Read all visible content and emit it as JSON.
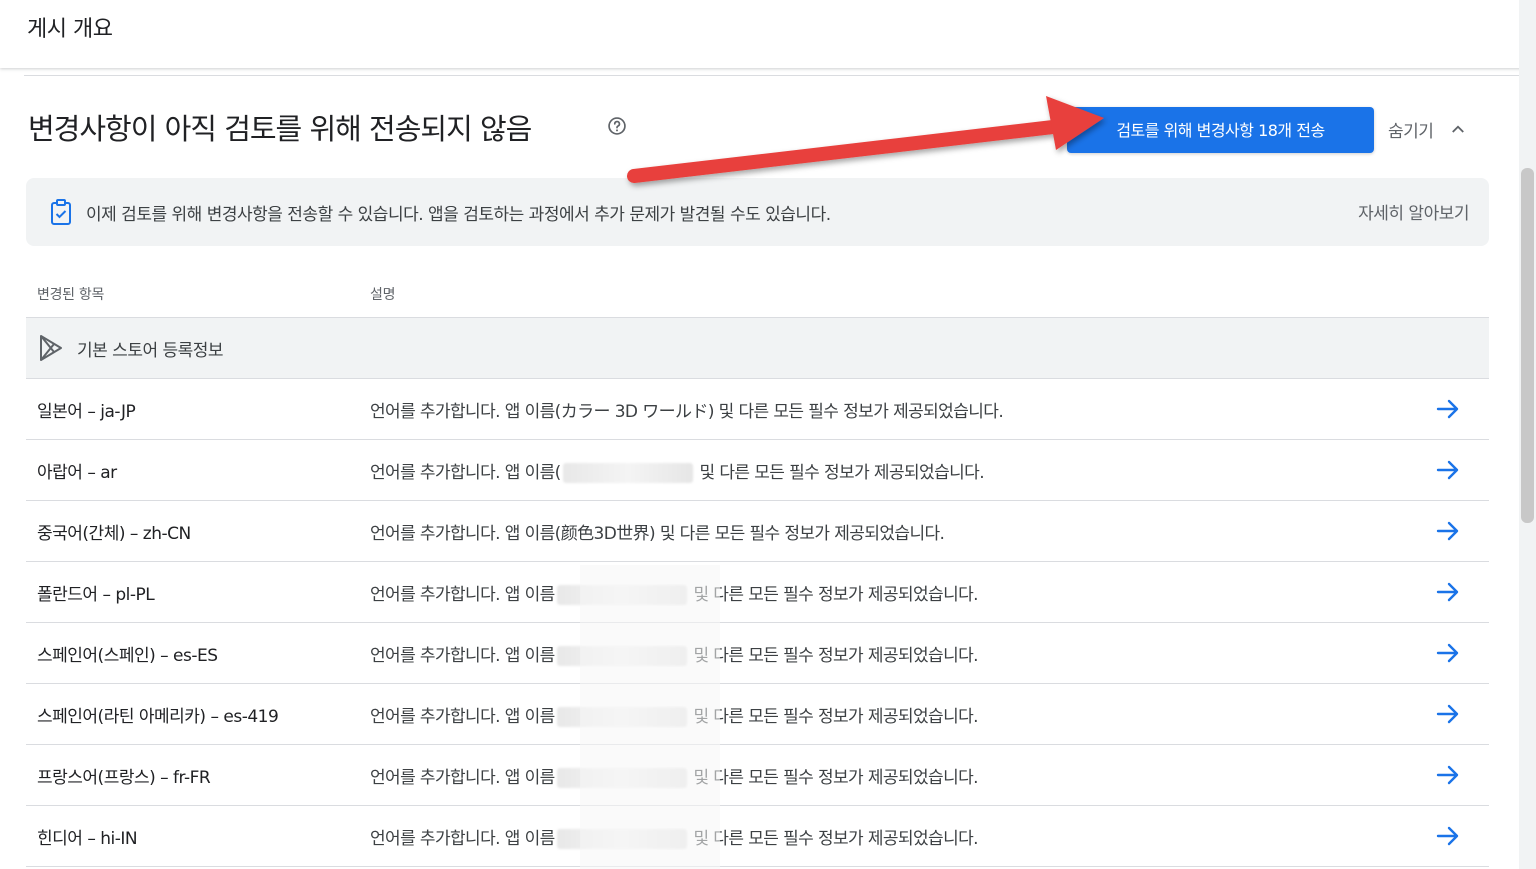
{
  "page": {
    "title": "게시 개요"
  },
  "header": {
    "heading": "변경사항이 아직 검토를 위해 전송되지 않음",
    "primary_button": "검토를 위해 변경사항 18개 전송",
    "hide_label": "숨기기"
  },
  "banner": {
    "text": "이제 검토를 위해 변경사항을 전송할 수 있습니다. 앱을 검토하는 과정에서 추가 문제가 발견될 수도 있습니다.",
    "link": "자세히 알아보기"
  },
  "table": {
    "col_changed": "변경된 항목",
    "col_desc": "설명",
    "group_label": "기본 스토어 등록정보",
    "rows": [
      {
        "lang": "일본어 – ja-JP",
        "desc_prefix": "언어를 추가합니다. 앱 이름(",
        "app_name": "カラー 3D ワールド",
        "desc_suffix": ") 및 다른 모든 필수 정보가 제공되었습니다."
      },
      {
        "lang": "아랍어 – ar",
        "desc_prefix": "언어를 추가합니다. 앱 이름(",
        "app_name": "",
        "desc_suffix": " 및 다른 모든 필수 정보가 제공되었습니다."
      },
      {
        "lang": "중국어(간체) – zh-CN",
        "desc_prefix": "언어를 추가합니다. 앱 이름(",
        "app_name": "颜色3D世界",
        "desc_suffix": ") 및 다른 모든 필수 정보가 제공되었습니다."
      },
      {
        "lang": "폴란드어 – pl-PL",
        "desc_prefix": "언어를 추가합니다. 앱 이름",
        "app_name": "",
        "desc_suffix": " 및 다른 모든 필수 정보가 제공되었습니다."
      },
      {
        "lang": "스페인어(스페인) – es-ES",
        "desc_prefix": "언어를 추가합니다. 앱 이름",
        "app_name": "",
        "desc_suffix": " 및 다른 모든 필수 정보가 제공되었습니다."
      },
      {
        "lang": "스페인어(라틴 아메리카) – es-419",
        "desc_prefix": "언어를 추가합니다. 앱 이름",
        "app_name": "",
        "desc_suffix": " 및 다른 모든 필수 정보가 제공되었습니다."
      },
      {
        "lang": "프랑스어(프랑스) – fr-FR",
        "desc_prefix": "언어를 추가합니다. 앱 이름",
        "app_name": "",
        "desc_suffix": " 및 다른 모든 필수 정보가 제공되었습니다."
      },
      {
        "lang": "힌디어 – hi-IN",
        "desc_prefix": "언어를 추가합니다. 앱 이름",
        "app_name": "",
        "desc_suffix": " 및 다른 모든 필수 정보가 제공되었습니다."
      }
    ]
  },
  "icons": {
    "help": "help-circle-icon",
    "chevron": "chevron-up-icon",
    "banner": "clipboard-check-icon",
    "group": "play-store-icon",
    "row_action": "arrow-right-icon"
  },
  "colors": {
    "primary": "#1a73e8",
    "annotation_arrow": "#e8413c",
    "banner_bg": "#f1f3f4"
  }
}
